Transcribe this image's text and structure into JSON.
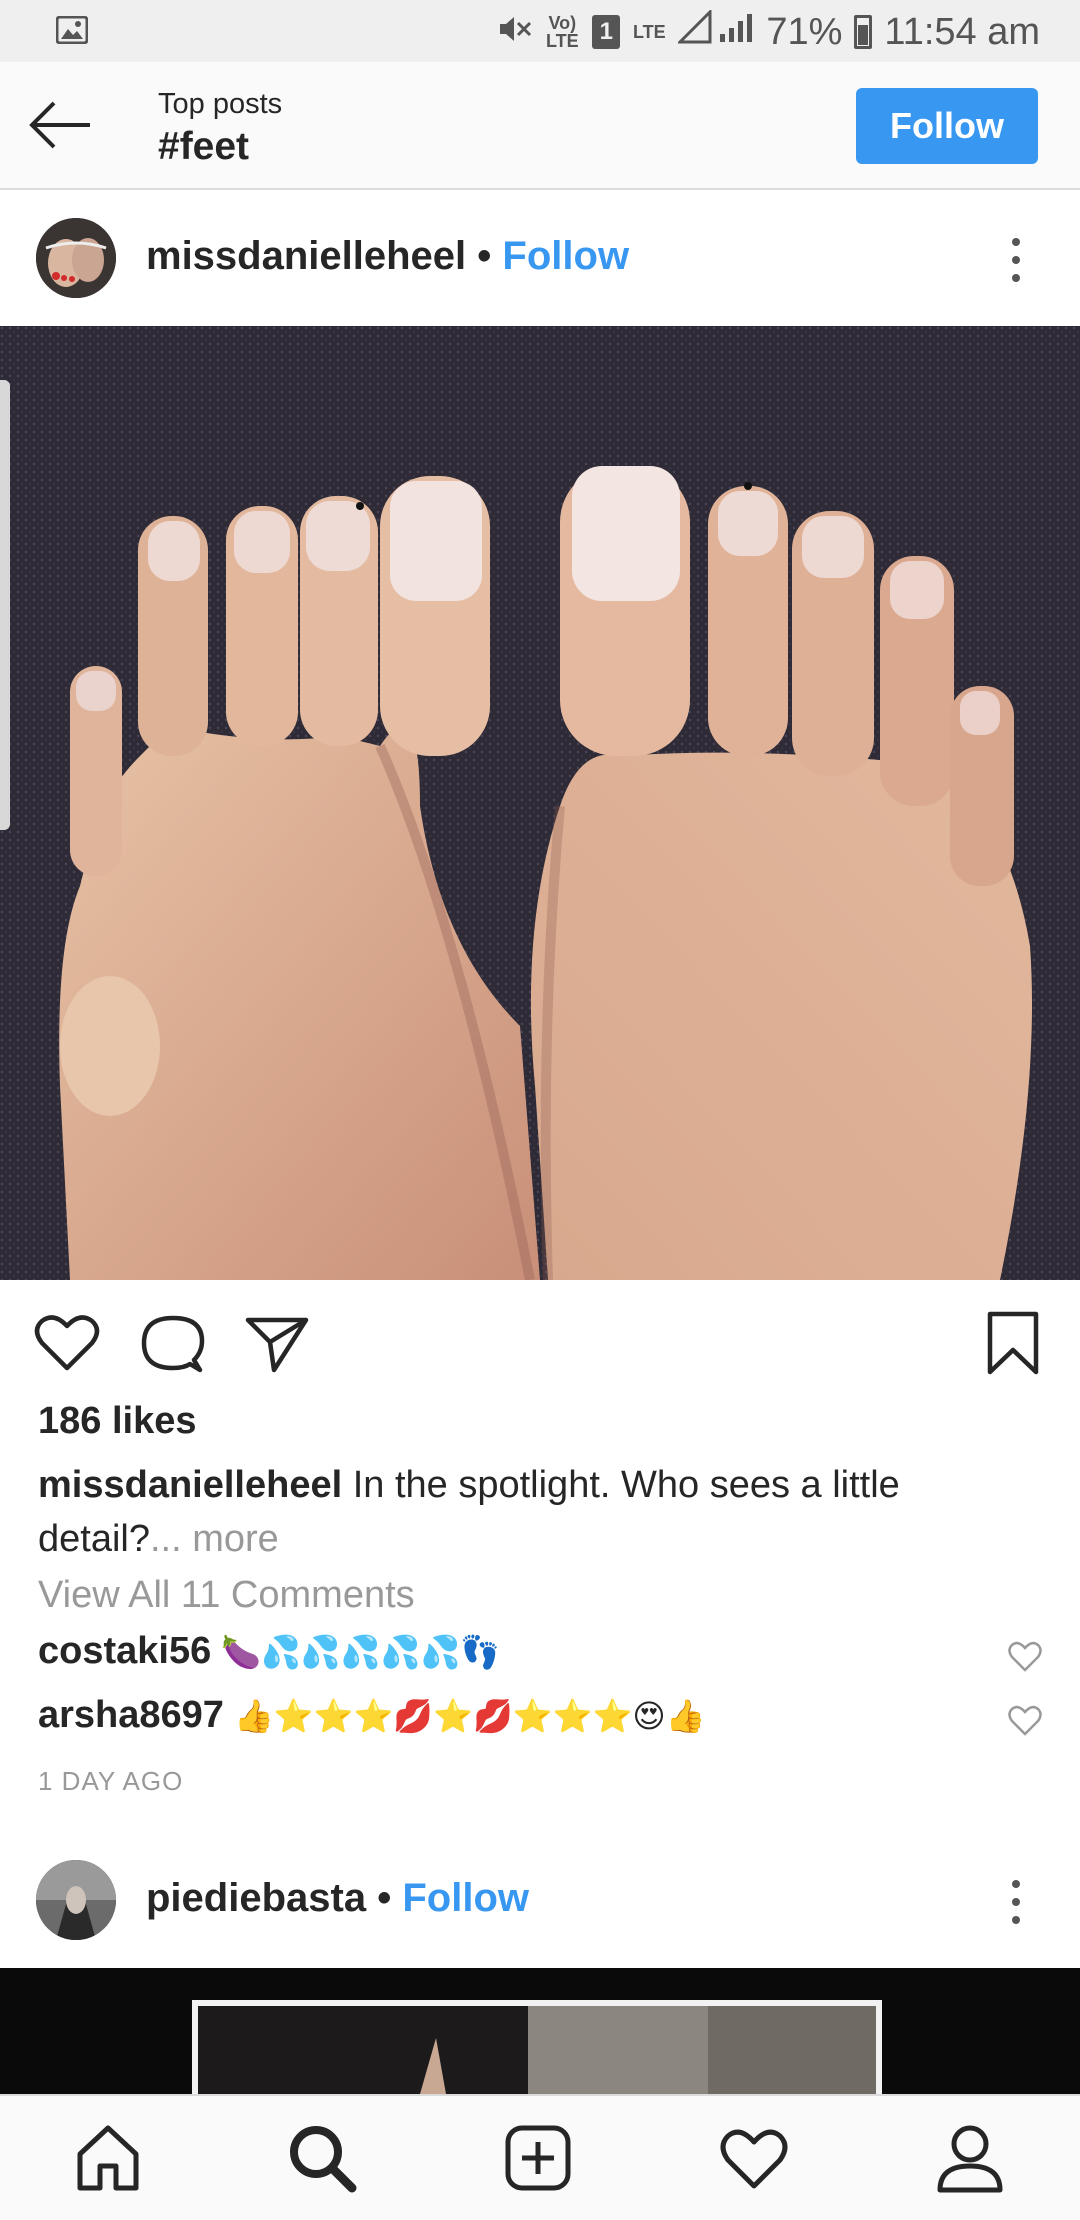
{
  "status_bar": {
    "network_label": "Vo) LTE",
    "sim_slot": "1",
    "lte_label": "LTE",
    "battery_percent": "71%",
    "time": "11:54 am"
  },
  "header": {
    "subtitle": "Top posts",
    "title": "#feet",
    "follow_label": "Follow"
  },
  "post1": {
    "username": "missdanielleheel",
    "separator": "•",
    "follow_label": "Follow",
    "likes": "186 likes",
    "caption_user": "missdanielleheel",
    "caption_text": "In the spotlight. Who sees a little detail?",
    "caption_more": "... more",
    "view_all_comments": "View All 11 Comments",
    "comments": [
      {
        "user": "costaki56",
        "text": "🍆💦💦💦💦💦👣"
      },
      {
        "user": "arsha8697",
        "text": "👍⭐⭐⭐💋⭐💋⭐⭐⭐😍👍"
      }
    ],
    "timestamp": "1 DAY AGO"
  },
  "post2": {
    "username": "piediebasta",
    "separator": "•",
    "follow_label": "Follow"
  },
  "icons": {
    "back": "arrow-left-icon",
    "more": "more-vertical-icon",
    "like": "heart-icon",
    "comment": "comment-icon",
    "share": "send-icon",
    "save": "bookmark-icon",
    "nav": [
      "home-icon",
      "search-icon",
      "add-icon",
      "activity-heart-icon",
      "profile-icon"
    ]
  },
  "colors": {
    "accent": "#3897f0",
    "text": "#262626",
    "muted": "#999999"
  }
}
